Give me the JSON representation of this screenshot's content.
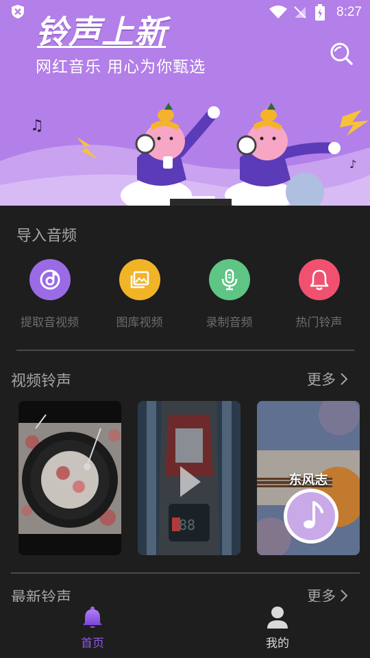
{
  "status_bar": {
    "time": "8:27"
  },
  "banner": {
    "title": "铃声上新",
    "subtitle": "网红音乐 用心为你甄选"
  },
  "import_section": {
    "title": "导入音频",
    "items": [
      {
        "label": "提取音视频",
        "icon": "music-disc-icon",
        "color": "#9b6be6"
      },
      {
        "label": "图库视频",
        "icon": "gallery-icon",
        "color": "#f2b427"
      },
      {
        "label": "录制音频",
        "icon": "microphone-icon",
        "color": "#5ec585"
      },
      {
        "label": "热门铃声",
        "icon": "bell-icon",
        "color": "#f0516f"
      }
    ]
  },
  "video_section": {
    "title": "视频铃声",
    "more": "更多",
    "cards": [
      {
        "overlay": ""
      },
      {
        "overlay": ""
      },
      {
        "overlay": "东风志"
      }
    ]
  },
  "latest_section": {
    "title": "最新铃声",
    "more": "更多"
  },
  "bottom_nav": {
    "items": [
      {
        "label": "首页",
        "icon": "bell-icon",
        "active": true,
        "color": "#8f58e6"
      },
      {
        "label": "我的",
        "icon": "user-icon",
        "active": false,
        "color": "#d9d9d9"
      }
    ]
  }
}
